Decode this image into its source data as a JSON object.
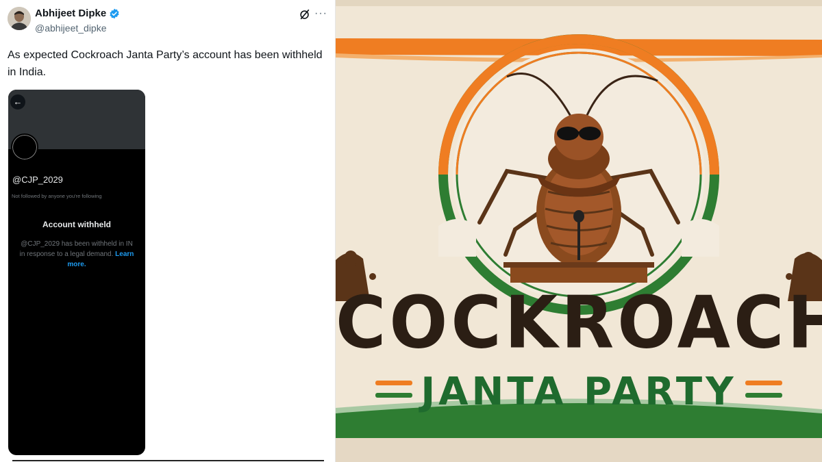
{
  "tweet": {
    "author_name": "Abhijeet Dipke",
    "author_handle": "@abhijeet_dipke",
    "text": "As expected Cockroach Janta Party’s account has been withheld in India.",
    "more_label": "···"
  },
  "embedded_screenshot": {
    "back_label": "←",
    "profile_handle": "@CJP_2029",
    "follow_note": "Not followed by anyone you're following",
    "withheld_title": "Account withheld",
    "withheld_message": "@CJP_2029 has been withheld in IN in response to a legal demand.",
    "learn_more_label": "Learn more."
  },
  "poster": {
    "line1": "COCKROACH",
    "line2": "JANTA PARTY",
    "colors": {
      "saffron": "#ef7d22",
      "green": "#2e7d32",
      "cream": "#f1e7d6",
      "brown": "#2b1e14"
    }
  },
  "colors": {
    "verified_badge": "#1d9bf0",
    "link_blue": "#1d9bf0",
    "text_primary": "#0f1419",
    "text_secondary": "#536471"
  }
}
